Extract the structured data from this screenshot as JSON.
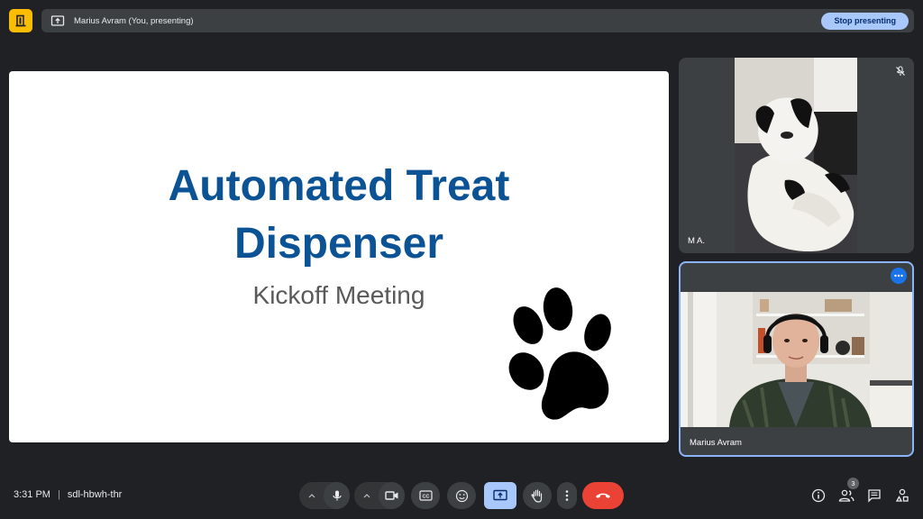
{
  "banner": {
    "text": "Marius Avram (You, presenting)",
    "stop_label": "Stop presenting"
  },
  "slide": {
    "title_line1": "Automated Treat",
    "title_line2": "Dispenser",
    "subtitle": "Kickoff Meeting"
  },
  "participants": [
    {
      "name": "M A.",
      "muted": true
    },
    {
      "name": "Marius Avram",
      "muted": false
    }
  ],
  "meeting": {
    "time": "3:31 PM",
    "separator": "|",
    "code": "sdl-hbwh-thr"
  },
  "people_count": "3",
  "icons": {
    "logo": "door-exit-icon",
    "presenting": "present-screen-icon",
    "mic": "microphone-icon",
    "camera": "video-camera-icon",
    "captions": "closed-captions-icon",
    "emoji": "emoji-icon",
    "present": "present-now-icon",
    "hand": "raise-hand-icon",
    "more": "more-vertical-icon",
    "end": "end-call-icon",
    "info": "info-icon",
    "people": "people-icon",
    "chat": "chat-icon",
    "activities": "activities-icon"
  },
  "colors": {
    "background": "#202124",
    "surface": "#3c4043",
    "accent_blue": "#a8c7fa",
    "title_blue": "#0b5394",
    "end_red": "#ea4335",
    "logo_yellow": "#fbbc04"
  }
}
